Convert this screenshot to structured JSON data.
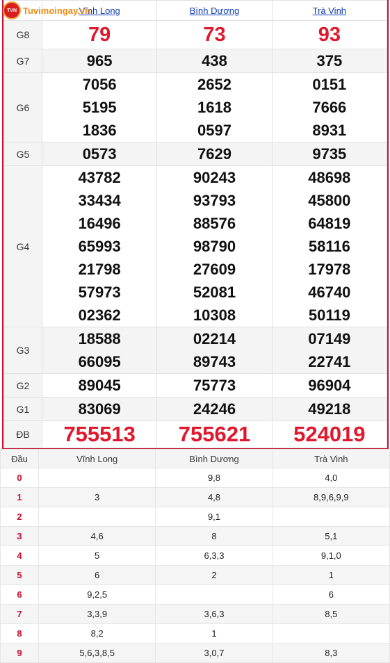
{
  "brand": {
    "logo_text": "Tuvimoingay.vn",
    "badge": "TVN"
  },
  "provinces": [
    "Vĩnh Long",
    "Bình Dương",
    "Trà Vinh"
  ],
  "prizes": [
    {
      "label": "G8",
      "values": [
        [
          "79"
        ],
        [
          "73"
        ],
        [
          "93"
        ]
      ]
    },
    {
      "label": "G7",
      "values": [
        [
          "965"
        ],
        [
          "438"
        ],
        [
          "375"
        ]
      ]
    },
    {
      "label": "G6",
      "values": [
        [
          "7056",
          "5195",
          "1836"
        ],
        [
          "2652",
          "1618",
          "0597"
        ],
        [
          "0151",
          "7666",
          "8931"
        ]
      ]
    },
    {
      "label": "G5",
      "values": [
        [
          "0573"
        ],
        [
          "7629"
        ],
        [
          "9735"
        ]
      ]
    },
    {
      "label": "G4",
      "values": [
        [
          "43782",
          "33434",
          "16496",
          "65993",
          "21798",
          "57973",
          "02362"
        ],
        [
          "90243",
          "93793",
          "88576",
          "98790",
          "27609",
          "52081",
          "10308"
        ],
        [
          "48698",
          "45800",
          "64819",
          "58116",
          "17978",
          "46740",
          "50119"
        ]
      ]
    },
    {
      "label": "G3",
      "values": [
        [
          "18588",
          "66095"
        ],
        [
          "02214",
          "89743"
        ],
        [
          "07149",
          "22741"
        ]
      ]
    },
    {
      "label": "G2",
      "values": [
        [
          "89045"
        ],
        [
          "75773"
        ],
        [
          "96904"
        ]
      ]
    },
    {
      "label": "G1",
      "values": [
        [
          "83069"
        ],
        [
          "24246"
        ],
        [
          "49218"
        ]
      ]
    },
    {
      "label": "ĐB",
      "values": [
        [
          "755513"
        ],
        [
          "755621"
        ],
        [
          "524019"
        ]
      ]
    }
  ],
  "dau_table": {
    "header": [
      "Đầu",
      "Vĩnh Long",
      "Bình Dương",
      "Trà Vinh"
    ],
    "rows": [
      [
        "0",
        "",
        "9,8",
        "4,0"
      ],
      [
        "1",
        "3",
        "4,8",
        "8,9,6,9,9"
      ],
      [
        "2",
        "",
        "9,1",
        ""
      ],
      [
        "3",
        "4,6",
        "8",
        "5,1"
      ],
      [
        "4",
        "5",
        "6,3,3",
        "9,1,0"
      ],
      [
        "5",
        "6",
        "2",
        "1"
      ],
      [
        "6",
        "9,2,5",
        "",
        "6"
      ],
      [
        "7",
        "3,3,9",
        "3,6,3",
        "8,5"
      ],
      [
        "8",
        "8,2",
        "1",
        ""
      ],
      [
        "9",
        "5,6,3,8,5",
        "3,0,7",
        "8,3"
      ]
    ]
  }
}
